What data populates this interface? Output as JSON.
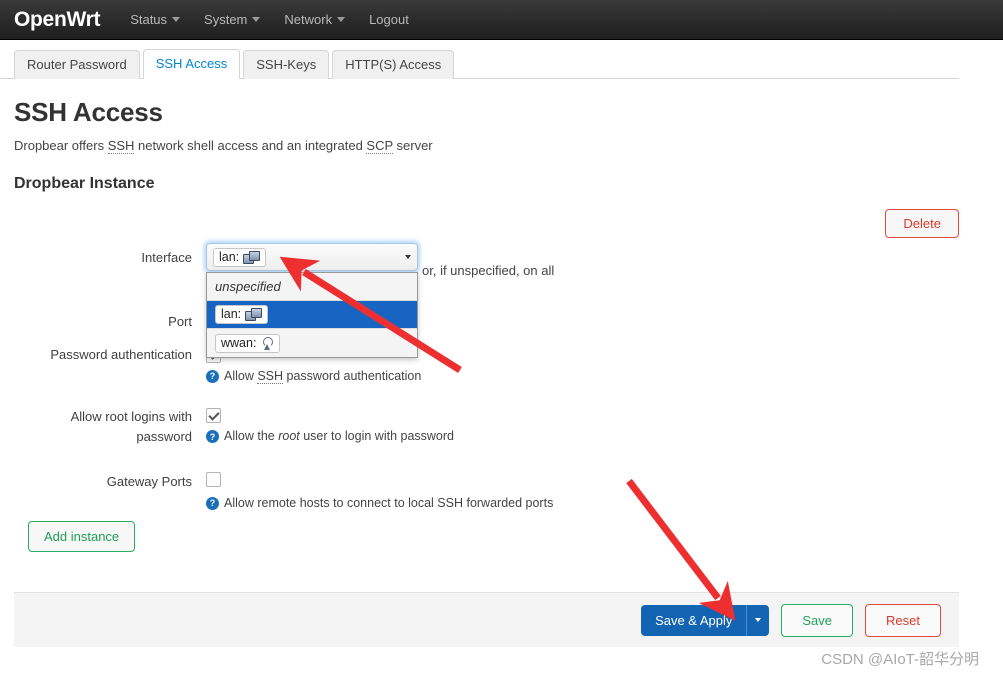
{
  "nav": {
    "brand": "OpenWrt",
    "items": [
      {
        "label": "Status",
        "caret": true
      },
      {
        "label": "System",
        "caret": true
      },
      {
        "label": "Network",
        "caret": true
      },
      {
        "label": "Logout",
        "caret": false
      }
    ]
  },
  "tabs": [
    {
      "label": "Router Password",
      "active": false
    },
    {
      "label": "SSH Access",
      "active": true
    },
    {
      "label": "SSH-Keys",
      "active": false
    },
    {
      "label": "HTTP(S) Access",
      "active": false
    }
  ],
  "page": {
    "title": "SSH Access",
    "desc_before": "Dropbear offers ",
    "desc_abbr1": "SSH",
    "desc_middle": " network shell access and an integrated ",
    "desc_abbr2": "SCP",
    "desc_after": " server",
    "section_title": "Dropbear Instance",
    "delete_label": "Delete",
    "add_instance_label": "Add instance"
  },
  "form": {
    "interface": {
      "label": "Interface",
      "selected": "lan:",
      "selected_icon": "lan-network-icon",
      "options": [
        {
          "label": "unspecified",
          "icon": null,
          "italic": true,
          "selected": false
        },
        {
          "label": "lan:",
          "icon": "lan-network-icon",
          "italic": false,
          "selected": true
        },
        {
          "label": "wwan:",
          "icon": "wireless-antenna-icon",
          "italic": false,
          "selected": false
        }
      ],
      "help_visible_fragment": "or, if unspecified, on all"
    },
    "port": {
      "label": "Port"
    },
    "password_auth": {
      "label": "Password authentication",
      "checked": true,
      "help_before": "Allow ",
      "help_abbr": "SSH",
      "help_after": " password authentication"
    },
    "root_login": {
      "label": "Allow root logins with password",
      "checked": true,
      "help_before": "Allow the ",
      "help_italic": "root",
      "help_after": " user to login with password"
    },
    "gateway_ports": {
      "label": "Gateway Ports",
      "checked": false,
      "help": "Allow remote hosts to connect to local SSH forwarded ports"
    }
  },
  "footer": {
    "save_apply_label": "Save & Apply",
    "save_label": "Save",
    "reset_label": "Reset"
  },
  "watermark": "CSDN @AIoT-韶华分明",
  "colors": {
    "accent_blue": "#1464b4",
    "green": "#27ae60",
    "red": "#e04a3f",
    "annotation_red": "#ee2f2f",
    "nav_dark": "#2a2a2a",
    "select_highlight": "#1864c2"
  }
}
